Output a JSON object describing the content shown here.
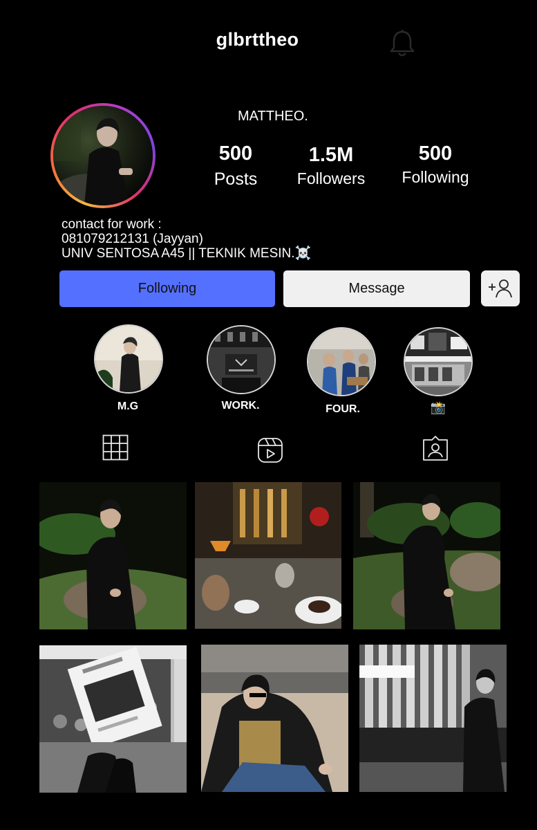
{
  "header": {
    "username": "glbrttheo",
    "notifications_icon": "bell-icon"
  },
  "profile": {
    "display_name": "MATTHEO.",
    "avatar_icon": "profile-avatar",
    "stats": {
      "posts": {
        "value": "500",
        "label": "Posts"
      },
      "followers": {
        "value": "1.5M",
        "label": "Followers"
      },
      "following": {
        "value": "500",
        "label": "Following"
      }
    },
    "bio": {
      "line1": "contact for work :",
      "line2": "081079212131 (Jayyan)",
      "line3": "UNIV SENTOSA A45 || TEKNIK MESIN.☠️"
    }
  },
  "actions": {
    "following_label": "Following",
    "message_label": "Message",
    "add_user_icon": "add-user-icon"
  },
  "highlights": [
    {
      "label": "M.G"
    },
    {
      "label": "WORK."
    },
    {
      "label": "FOUR."
    },
    {
      "label": "📸"
    }
  ],
  "tabs": [
    {
      "icon": "grid-icon"
    },
    {
      "icon": "reels-icon"
    },
    {
      "icon": "tagged-icon"
    }
  ],
  "colors": {
    "background": "#000000",
    "following_button": "#5470ff",
    "message_button": "#f0f0f0"
  }
}
